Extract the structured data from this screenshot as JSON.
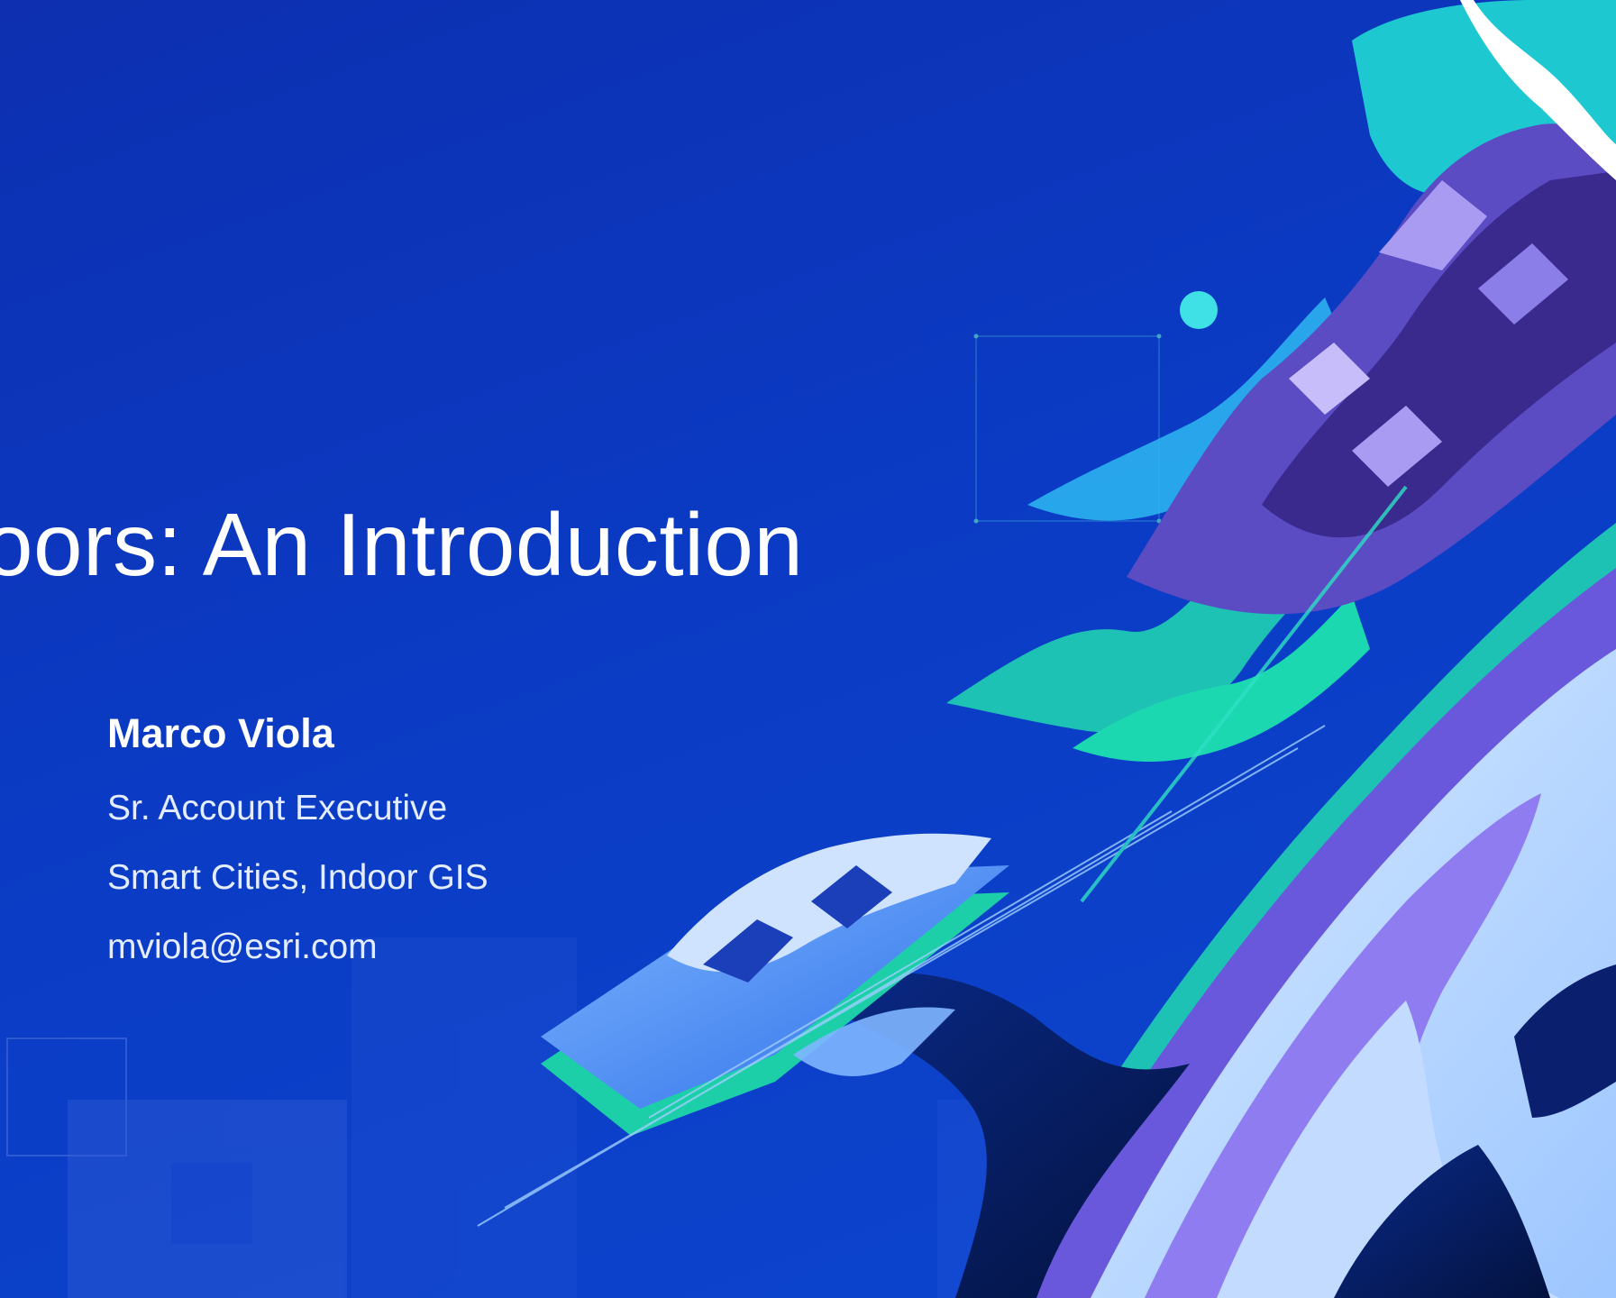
{
  "slide": {
    "title": "oors: An Introduction",
    "presenter": {
      "name": "Marco Viola",
      "role": "Sr. Account Executive",
      "focus": "Smart Cities, Indoor GIS",
      "email": "mviola@esri.com"
    }
  },
  "colors": {
    "background": "#0b3bc4",
    "text": "#ffffff",
    "accent_teal": "#24d3c0",
    "accent_purple": "#7a63e6",
    "accent_light": "#cfe3ff"
  },
  "icons": [
    "mountain-illustration",
    "globe-illustration",
    "map-tile-illustration"
  ]
}
